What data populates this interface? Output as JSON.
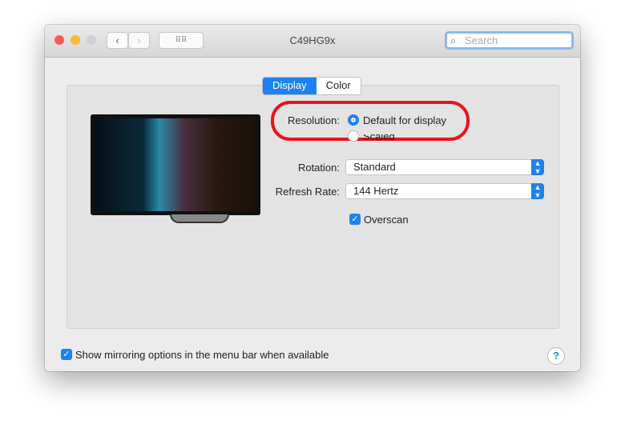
{
  "window": {
    "title": "C49HG9x",
    "search_placeholder": "Search"
  },
  "tabs": [
    {
      "label": "Display"
    },
    {
      "label": "Color"
    }
  ],
  "resolution": {
    "label": "Resolution:",
    "options": [
      "Default for display",
      "Scaled"
    ],
    "selected": "Default for display"
  },
  "rotation": {
    "label": "Rotation:",
    "value": "Standard"
  },
  "refresh": {
    "label": "Refresh Rate:",
    "value": "144 Hertz"
  },
  "overscan": {
    "label": "Overscan",
    "checked": true
  },
  "mirroring": {
    "label": "Show mirroring options in the menu bar when available",
    "checked": true
  },
  "colors": {
    "accent": "#1e82f0",
    "highlight": "#e8141b"
  }
}
